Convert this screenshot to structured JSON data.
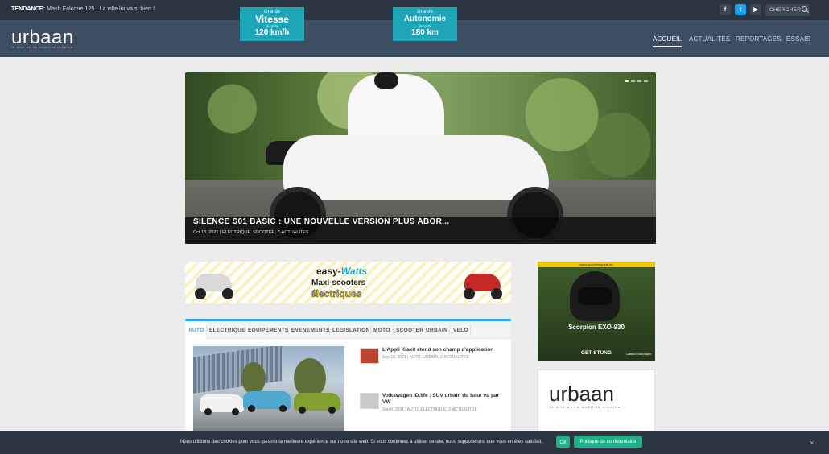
{
  "topbar": {
    "tendance_label": "TENDANCE:",
    "tendance_text": "Mash Falcone 125 : La ville lui va si bien !",
    "social": {
      "facebook": "f",
      "twitter": "t",
      "youtube": "▶"
    },
    "search_label": "CHERCHER"
  },
  "header": {
    "logo": "urbaan",
    "tagline": "le site de la mobilité urbaine",
    "nav": [
      "ACCUEIL",
      "ACTUALITÉS",
      "REPORTAGES",
      "ESSAIS"
    ]
  },
  "hero": {
    "title": "SILENCE S01 BASIC : UNE NOUVELLE VERSION PLUS ABOR...",
    "meta": "Oct 13, 2021 | ELECTRIQUE, SCOOTER, Z-ACTUALITES"
  },
  "banner": {
    "badge1": {
      "l1": "Grande",
      "l2": "Vitesse",
      "l3": "jusqu'à",
      "l4": "120 km/h"
    },
    "brand": "easy-",
    "brand_accent": "Watts",
    "sub": "Maxi-scooters",
    "sub2": "électriques",
    "badge2": {
      "l1": "Grande",
      "l2": "Autonomie",
      "l3": "jusqu'à",
      "l4": "180 km"
    }
  },
  "side_ad": {
    "url": "www.scorpionsports.eu",
    "name": "Scorpion EXO-930",
    "slogan": "GET STUNG",
    "small": "Laissez-vous piquer"
  },
  "side_box": {
    "logo": "urbaan",
    "tagline": "le site de la mobilité urbaine"
  },
  "tabs": [
    "AUTO",
    "ELECTRIQUE",
    "EQUIPEMENTS",
    "EVENEMENTS",
    "LEGISLATION",
    "MOTO",
    "SCOOTER",
    "URBAIN",
    "VELO"
  ],
  "articles": [
    {
      "title": "L'Appli Klaxit étend son champ d'application",
      "meta": "Sep 18, 2021 | AUTO, URBAIN, Z-ACTUALITES"
    },
    {
      "title": "Volkswagen ID.life : SUV urbain du futur vu par VW",
      "meta": "Sep 8, 2021 | AUTO, ELECTRIQUE, Z-ACTUALITES"
    }
  ],
  "cookie": {
    "text": "Nous utilisons des cookies pour vous garantir la meilleure expérience sur notre site web. Si vous continuez à utiliser ce site, nous supposerons que vous en êtes satisfait.",
    "ok": "Ok",
    "policy": "Politique de confidentialité",
    "close": "×"
  },
  "colors": {
    "accent": "#2ea3f2",
    "header": "#3d4d62",
    "topbar": "#2b3542",
    "cookie_btn": "#1bb287"
  }
}
